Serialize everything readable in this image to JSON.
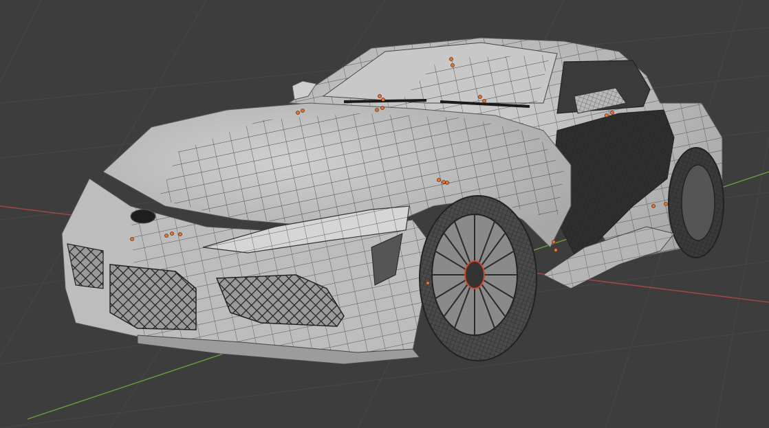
{
  "viewport": {
    "mode": "3d-viewport",
    "object": "sports-car-mesh",
    "shading": "solid-wireframe-overlay"
  },
  "colors": {
    "background": "#3d3d3d",
    "grid_line": "#484848",
    "x_axis": "#a2454a",
    "y_axis": "#6e9d3a",
    "mesh_body": "#bcbcbc",
    "mesh_shadow": "#8a8a8a",
    "wire": "#2a2a2a",
    "glass_dark": "#2c2c2c",
    "tire": "#4a4a4a",
    "vertex_selected": "#e4762c"
  }
}
